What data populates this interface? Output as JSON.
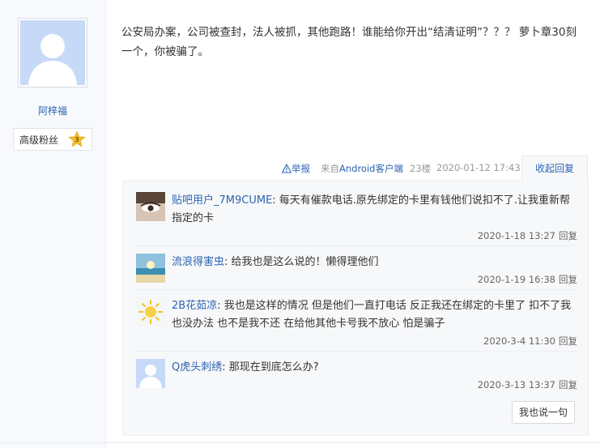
{
  "author": {
    "name": "阿梓福",
    "fan_level_label": "高级粉丝",
    "fan_level_number": "3"
  },
  "post": {
    "content": "公安局办案，公司被查封，法人被抓，其他跑路！谁能给你开出“结清证明”？？？ 萝卜章30刻一个，你被骗了。",
    "report_label": "举报",
    "source_prefix": "来自",
    "source_client": "Android客户端",
    "floor": "23楼",
    "time": "2020-01-12 17:43",
    "collapse_label": "收起回复"
  },
  "replies": [
    {
      "user": "贴吧用户_7M9CUME",
      "text": "每天有催款电话.原先绑定的卡里有钱他们说扣不了.让我重新帮指定的卡",
      "time": "2020-1-18 13:27",
      "reply_label": "回复",
      "avatar": "photo-eye-avatar"
    },
    {
      "user": "流浪得害虫",
      "text": "给我也是这么说的！懒得理他们",
      "time": "2020-1-19 16:38",
      "reply_label": "回复",
      "avatar": "beach-avatar"
    },
    {
      "user": "2B花茹凉",
      "text": "我也是这样的情况 但是他们一直打电话 反正我还在绑定的卡里了 扣不了我也没办法 也不是我不还 在给他其他卡号我不放心 怕是骗子",
      "time": "2020-3-4 11:30",
      "reply_label": "回复",
      "avatar": "sun-avatar"
    },
    {
      "user": "Q虎头刺绣",
      "text": "那现在到底怎么办?",
      "time": "2020-3-13 13:37",
      "reply_label": "回复",
      "avatar": "default-avatar"
    }
  ],
  "say_button_label": "我也说一句",
  "colors": {
    "link": "#2d64b3",
    "panel_bg": "#f7f8fa",
    "avatar_bg": "#c6daf7"
  }
}
